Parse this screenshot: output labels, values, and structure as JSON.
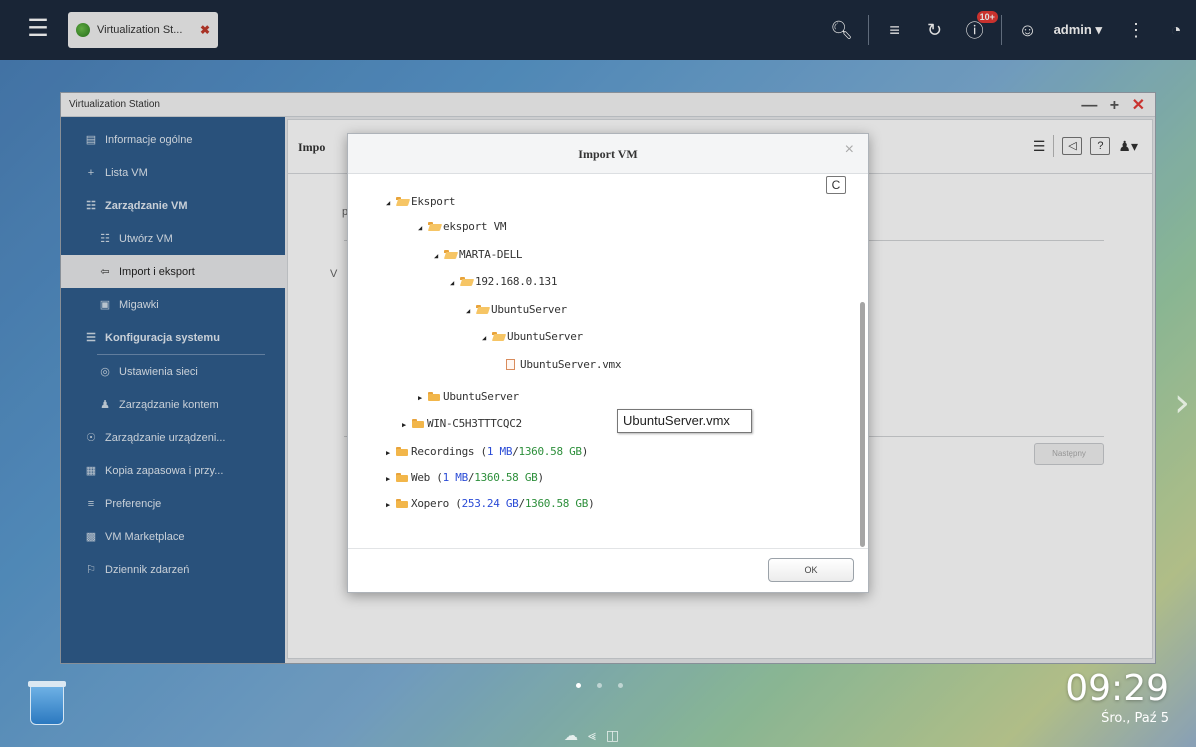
{
  "taskbar": {
    "tab_label": "Virtualization St...",
    "tab_close": "✖",
    "notification_badge": "10+",
    "user": "admin ▾"
  },
  "window": {
    "title": "Virtualization Station",
    "controls": [
      "—",
      "+",
      "✕"
    ]
  },
  "sidebar": {
    "items": [
      {
        "label": "Informacje ogólne",
        "icon": "info-icon"
      },
      {
        "label": "Lista VM",
        "icon": "plus-icon"
      },
      {
        "label": "Zarządzanie VM",
        "icon": "vm-icon"
      },
      {
        "label": "Utwórz VM",
        "icon": "vm-create-icon"
      },
      {
        "label": "Import i eksport",
        "icon": "import-icon"
      },
      {
        "label": "Migawki",
        "icon": "snapshot-icon"
      },
      {
        "label": "Konfiguracja systemu",
        "icon": "config-icon"
      },
      {
        "label": "Ustawienia sieci",
        "icon": "network-icon"
      },
      {
        "label": "Zarządzanie kontem",
        "icon": "account-icon"
      },
      {
        "label": "Zarządzanie urządzeni...",
        "icon": "device-icon"
      },
      {
        "label": "Kopia zapasowa i przy...",
        "icon": "backup-icon"
      },
      {
        "label": "Preferencje",
        "icon": "prefs-icon"
      },
      {
        "label": "VM Marketplace",
        "icon": "marketplace-icon"
      },
      {
        "label": "Dziennik zdarzeń",
        "icon": "log-icon"
      }
    ]
  },
  "content": {
    "title": "Impo",
    "frag_p": "p",
    "frag_w": "V",
    "next_label": "Następny"
  },
  "modal": {
    "title": "Import VM",
    "close": "×",
    "refresh": "C",
    "ok_label": "OK",
    "tree": [
      {
        "name": "Eksport",
        "indent": 1,
        "open": true,
        "kind": "folder"
      },
      {
        "name": "eksport VM",
        "indent": 2,
        "open": true,
        "kind": "folder"
      },
      {
        "name": "MARTA-DELL",
        "indent": 3,
        "open": true,
        "kind": "folder"
      },
      {
        "name": "192.168.0.131",
        "indent": 4,
        "open": true,
        "kind": "folder"
      },
      {
        "name": "UbuntuServer",
        "indent": 5,
        "open": true,
        "kind": "folder"
      },
      {
        "name": "UbuntuServer",
        "indent": 6,
        "open": true,
        "kind": "folder"
      },
      {
        "name": "UbuntuServer.vmx",
        "indent": 7,
        "kind": "file"
      },
      {
        "name": "UbuntuServer",
        "indent": 2,
        "open": false,
        "kind": "folder"
      },
      {
        "name": "WIN-C5H3TTTCQC2",
        "indent": 1,
        "open": false,
        "kind": "folder"
      },
      {
        "name": "Recordings",
        "used": "1 MB",
        "total": "1360.58 GB",
        "indent": 0,
        "open": false,
        "kind": "share"
      },
      {
        "name": "Web",
        "used": "1 MB",
        "total": "1360.58 GB",
        "indent": 0,
        "open": false,
        "kind": "share"
      },
      {
        "name": "Xopero",
        "used": "253.24 GB",
        "total": "1360.58 GB",
        "indent": 0,
        "open": false,
        "kind": "share"
      }
    ]
  },
  "tooltip": "UbuntuServer.vmx",
  "desktop": {
    "time": "09:29",
    "date": "Śro., Paź 5"
  }
}
